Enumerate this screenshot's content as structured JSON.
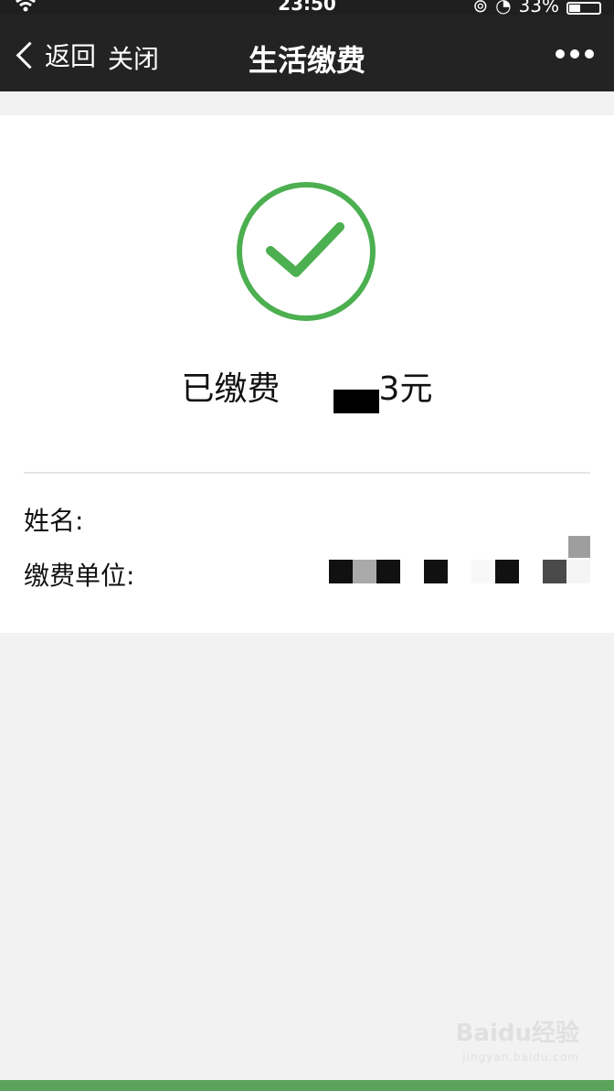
{
  "status_bar": {
    "time": "23:50",
    "battery": "33%"
  },
  "nav": {
    "back_label": "返回",
    "close_label": "关闭",
    "title": "生活缴费"
  },
  "result": {
    "paid_prefix": "已缴费",
    "paid_suffix": "3元",
    "status_color": "#4caf50"
  },
  "details": {
    "name_label": "姓名:",
    "company_label": "缴费单位:"
  },
  "watermark": {
    "brand": "Baidu经验",
    "url": "jingyan.baidu.com"
  }
}
